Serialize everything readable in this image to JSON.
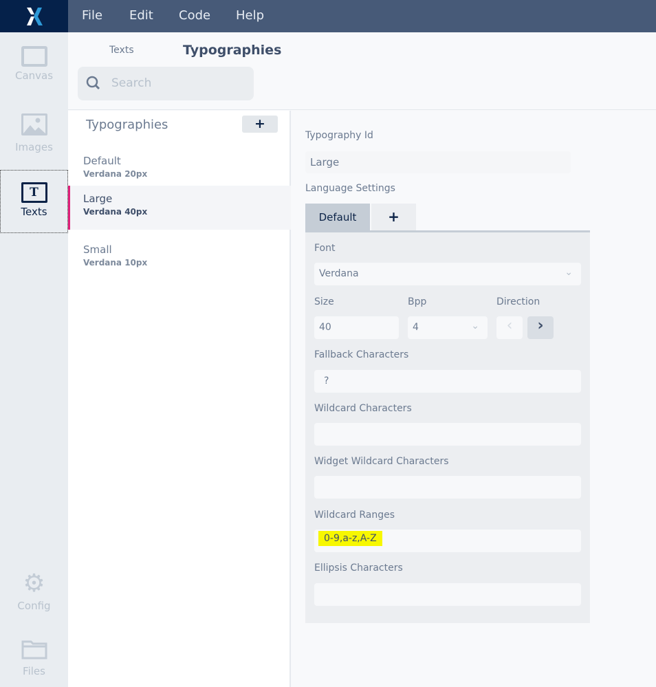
{
  "menu": {
    "items": [
      "File",
      "Edit",
      "Code",
      "Help"
    ]
  },
  "sidebar": {
    "canvas": "Canvas",
    "images": "Images",
    "texts": "Texts",
    "config": "Config",
    "files": "Files"
  },
  "nav": {
    "tab_texts": "Texts",
    "tab_typographies": "Typographies",
    "search_placeholder": "Search"
  },
  "list": {
    "title": "Typographies",
    "add": "+",
    "items": [
      {
        "name": "Default",
        "detail": "Verdana  20px"
      },
      {
        "name": "Large",
        "detail": "Verdana  40px"
      },
      {
        "name": "Small",
        "detail": "Verdana  10px"
      }
    ]
  },
  "detail": {
    "id_label": "Typography Id",
    "id_value": "Large",
    "lang_label": "Language Settings",
    "tab_default": "Default",
    "tab_add": "+",
    "font_label": "Font",
    "font_value": "Verdana",
    "size_label": "Size",
    "size_value": "40",
    "bpp_label": "Bpp",
    "bpp_value": "4",
    "direction_label": "Direction",
    "fallback_label": "Fallback Characters",
    "fallback_value": "?",
    "wildcard_label": "Wildcard Characters",
    "wildcard_value": "",
    "widget_label": "Widget Wildcard Characters",
    "widget_value": "",
    "ranges_label": "Wildcard Ranges",
    "ranges_value": "0-9,a-z,A-Z",
    "ellipsis_label": "Ellipsis Characters",
    "ellipsis_value": ""
  },
  "colors": {
    "accent": "#e0207a",
    "highlight": "#f7f700"
  }
}
